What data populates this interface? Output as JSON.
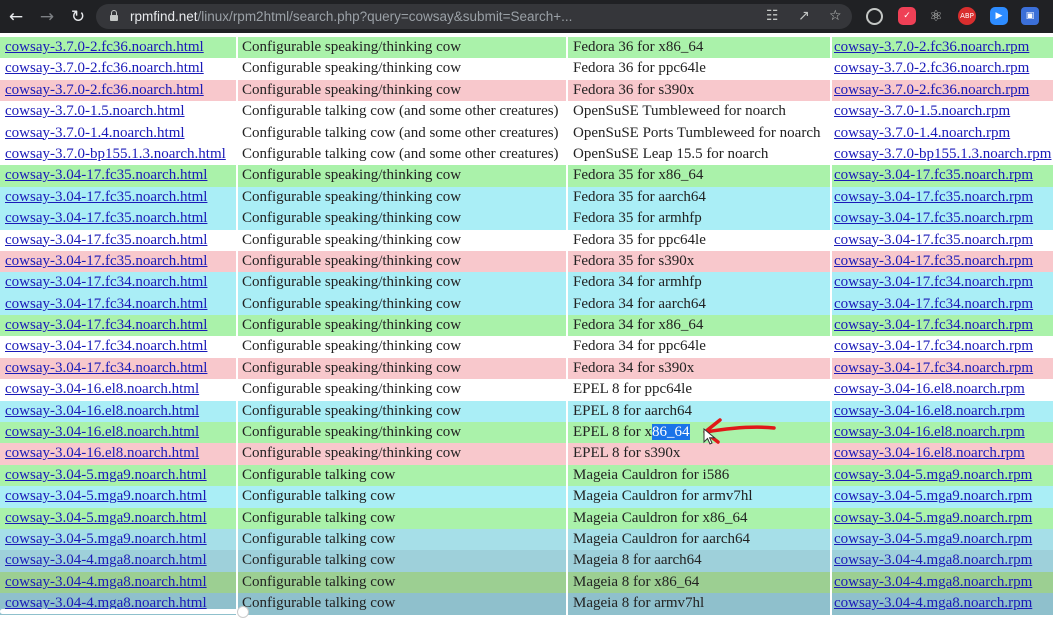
{
  "browser": {
    "url_host": "rpmfind.net",
    "url_path": "/linux/rpm2html/search.php?query=cowsay&submit=Search+...",
    "extensions": [
      {
        "name": "abp",
        "label": "ABP",
        "color": "#d92e2e"
      },
      {
        "name": "zoom",
        "label": "",
        "color": "#2d8cff"
      },
      {
        "name": "profile",
        "label": "",
        "color": "#3b6fd8"
      }
    ]
  },
  "selected_text": "86_64",
  "rows": [
    {
      "html": "cowsay-3.7.0-2.fc36.noarch.html",
      "desc": "Configurable speaking/thinking cow",
      "distro": "Fedora 36 for x86_64",
      "rpm": "cowsay-3.7.0-2.fc36.noarch.rpm",
      "color": "#aaf2aa"
    },
    {
      "html": "cowsay-3.7.0-2.fc36.noarch.html",
      "desc": "Configurable speaking/thinking cow",
      "distro": "Fedora 36 for ppc64le",
      "rpm": "cowsay-3.7.0-2.fc36.noarch.rpm",
      "color": "#ffffff"
    },
    {
      "html": "cowsay-3.7.0-2.fc36.noarch.html",
      "desc": "Configurable speaking/thinking cow",
      "distro": "Fedora 36 for s390x",
      "rpm": "cowsay-3.7.0-2.fc36.noarch.rpm",
      "color": "#f8c8cc"
    },
    {
      "html": "cowsay-3.7.0-1.5.noarch.html",
      "desc": "Configurable talking cow (and some other creatures)",
      "distro": "OpenSuSE Tumbleweed for noarch",
      "rpm": "cowsay-3.7.0-1.5.noarch.rpm",
      "color": "#ffffff"
    },
    {
      "html": "cowsay-3.7.0-1.4.noarch.html",
      "desc": "Configurable talking cow (and some other creatures)",
      "distro": "OpenSuSE Ports Tumbleweed for noarch",
      "rpm": "cowsay-3.7.0-1.4.noarch.rpm",
      "color": "#ffffff"
    },
    {
      "html": "cowsay-3.7.0-bp155.1.3.noarch.html",
      "desc": "Configurable talking cow (and some other creatures)",
      "distro": "OpenSuSE Leap 15.5 for noarch",
      "rpm": "cowsay-3.7.0-bp155.1.3.noarch.rpm",
      "color": "#ffffff"
    },
    {
      "html": "cowsay-3.04-17.fc35.noarch.html",
      "desc": "Configurable speaking/thinking cow",
      "distro": "Fedora 35 for x86_64",
      "rpm": "cowsay-3.04-17.fc35.noarch.rpm",
      "color": "#aaf2aa"
    },
    {
      "html": "cowsay-3.04-17.fc35.noarch.html",
      "desc": "Configurable speaking/thinking cow",
      "distro": "Fedora 35 for aarch64",
      "rpm": "cowsay-3.04-17.fc35.noarch.rpm",
      "color": "#aaeef6"
    },
    {
      "html": "cowsay-3.04-17.fc35.noarch.html",
      "desc": "Configurable speaking/thinking cow",
      "distro": "Fedora 35 for armhfp",
      "rpm": "cowsay-3.04-17.fc35.noarch.rpm",
      "color": "#aaeef6"
    },
    {
      "html": "cowsay-3.04-17.fc35.noarch.html",
      "desc": "Configurable speaking/thinking cow",
      "distro": "Fedora 35 for ppc64le",
      "rpm": "cowsay-3.04-17.fc35.noarch.rpm",
      "color": "#ffffff"
    },
    {
      "html": "cowsay-3.04-17.fc35.noarch.html",
      "desc": "Configurable speaking/thinking cow",
      "distro": "Fedora 35 for s390x",
      "rpm": "cowsay-3.04-17.fc35.noarch.rpm",
      "color": "#f8c8cc"
    },
    {
      "html": "cowsay-3.04-17.fc34.noarch.html",
      "desc": "Configurable speaking/thinking cow",
      "distro": "Fedora 34 for armhfp",
      "rpm": "cowsay-3.04-17.fc34.noarch.rpm",
      "color": "#aaeef6"
    },
    {
      "html": "cowsay-3.04-17.fc34.noarch.html",
      "desc": "Configurable speaking/thinking cow",
      "distro": "Fedora 34 for aarch64",
      "rpm": "cowsay-3.04-17.fc34.noarch.rpm",
      "color": "#aaeef6"
    },
    {
      "html": "cowsay-3.04-17.fc34.noarch.html",
      "desc": "Configurable speaking/thinking cow",
      "distro": "Fedora 34 for x86_64",
      "rpm": "cowsay-3.04-17.fc34.noarch.rpm",
      "color": "#aaf2aa"
    },
    {
      "html": "cowsay-3.04-17.fc34.noarch.html",
      "desc": "Configurable speaking/thinking cow",
      "distro": "Fedora 34 for ppc64le",
      "rpm": "cowsay-3.04-17.fc34.noarch.rpm",
      "color": "#ffffff"
    },
    {
      "html": "cowsay-3.04-17.fc34.noarch.html",
      "desc": "Configurable speaking/thinking cow",
      "distro": "Fedora 34 for s390x",
      "rpm": "cowsay-3.04-17.fc34.noarch.rpm",
      "color": "#f8c8cc"
    },
    {
      "html": "cowsay-3.04-16.el8.noarch.html",
      "desc": "Configurable speaking/thinking cow",
      "distro": "EPEL 8 for ppc64le",
      "rpm": "cowsay-3.04-16.el8.noarch.rpm",
      "color": "#ffffff"
    },
    {
      "html": "cowsay-3.04-16.el8.noarch.html",
      "desc": "Configurable speaking/thinking cow",
      "distro": "EPEL 8 for aarch64",
      "rpm": "cowsay-3.04-16.el8.noarch.rpm",
      "color": "#aaeef6"
    },
    {
      "html": "cowsay-3.04-16.el8.noarch.html",
      "desc": "Configurable speaking/thinking cow",
      "distro": "EPEL 8 for x86_64",
      "rpm": "cowsay-3.04-16.el8.noarch.rpm",
      "color": "#aaf2aa"
    },
    {
      "html": "cowsay-3.04-16.el8.noarch.html",
      "desc": "Configurable speaking/thinking cow",
      "distro": "EPEL 8 for s390x",
      "rpm": "cowsay-3.04-16.el8.noarch.rpm",
      "color": "#f8c8cc"
    },
    {
      "html": "cowsay-3.04-5.mga9.noarch.html",
      "desc": "Configurable talking cow",
      "distro": "Mageia Cauldron for i586",
      "rpm": "cowsay-3.04-5.mga9.noarch.rpm",
      "color": "#aaf2aa"
    },
    {
      "html": "cowsay-3.04-5.mga9.noarch.html",
      "desc": "Configurable talking cow",
      "distro": "Mageia Cauldron for armv7hl",
      "rpm": "cowsay-3.04-5.mga9.noarch.rpm",
      "color": "#aaeef6"
    },
    {
      "html": "cowsay-3.04-5.mga9.noarch.html",
      "desc": "Configurable talking cow",
      "distro": "Mageia Cauldron for x86_64",
      "rpm": "cowsay-3.04-5.mga9.noarch.rpm",
      "color": "#aaf2aa"
    },
    {
      "html": "cowsay-3.04-5.mga9.noarch.html",
      "desc": "Configurable talking cow",
      "distro": "Mageia Cauldron for aarch64",
      "rpm": "cowsay-3.04-5.mga9.noarch.rpm",
      "color": "#a6dfe8"
    },
    {
      "html": "cowsay-3.04-4.mga8.noarch.html",
      "desc": "Configurable talking cow",
      "distro": "Mageia 8 for aarch64",
      "rpm": "cowsay-3.04-4.mga8.noarch.rpm",
      "color": "#9ed0da"
    },
    {
      "html": "cowsay-3.04-4.mga8.noarch.html",
      "desc": "Configurable talking cow",
      "distro": "Mageia 8 for x86_64",
      "rpm": "cowsay-3.04-4.mga8.noarch.rpm",
      "color": "#9ccf92"
    },
    {
      "html": "cowsay-3.04-4.mga8.noarch.html",
      "desc": "Configurable talking cow",
      "distro": "Mageia 8 for armv7hl",
      "rpm": "cowsay-3.04-4.mga8.noarch.rpm",
      "color": "#8fc0cc"
    }
  ]
}
